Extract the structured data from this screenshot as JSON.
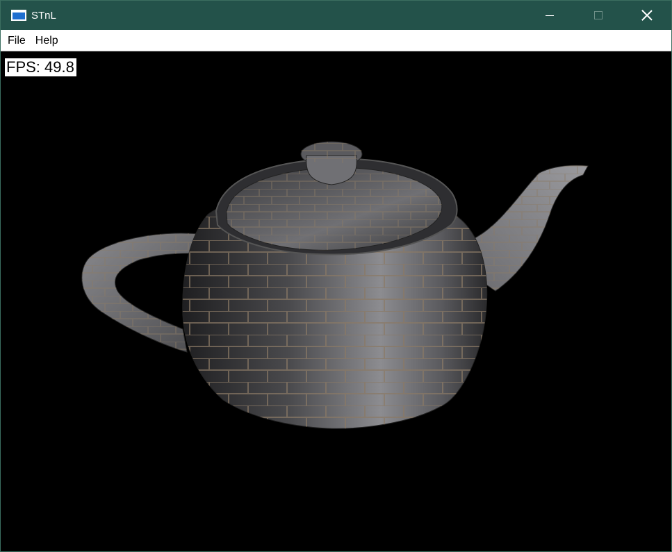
{
  "window": {
    "title": "STnL"
  },
  "menu": {
    "items": [
      "File",
      "Help"
    ]
  },
  "overlay": {
    "fps_text": "FPS: 49.8"
  },
  "colors": {
    "titlebar": "#23524a",
    "viewport_bg": "#000000",
    "stone_light": "#a7a7a7",
    "stone_dark": "#2c2c2e",
    "mortar": "#8a7a66"
  },
  "icons": [
    "app-window-icon",
    "minimize-icon",
    "maximize-icon",
    "close-icon"
  ]
}
